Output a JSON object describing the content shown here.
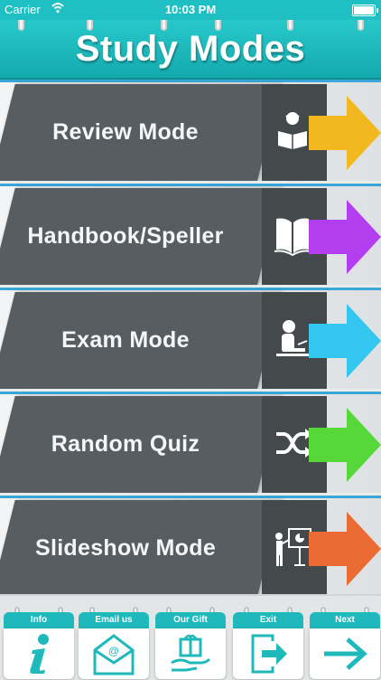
{
  "status_bar": {
    "carrier": "Carrier",
    "time": "10:03 PM"
  },
  "header": {
    "title": "Study Modes"
  },
  "modes": [
    {
      "label": "Review Mode",
      "icon": "reader-icon",
      "arrow_color": "#f2b81f"
    },
    {
      "label": "Handbook/Speller",
      "icon": "book-icon",
      "arrow_color": "#b23ef0"
    },
    {
      "label": "Exam Mode",
      "icon": "student-writing-icon",
      "arrow_color": "#33c6ee"
    },
    {
      "label": "Random Quiz",
      "icon": "shuffle-icon",
      "arrow_color": "#56d83b"
    },
    {
      "label": "Slideshow Mode",
      "icon": "presentation-icon",
      "arrow_color": "#ec6a33"
    }
  ],
  "bottom_bar": [
    {
      "label": "Info",
      "icon": "info-icon"
    },
    {
      "label": "Email us",
      "icon": "email-icon"
    },
    {
      "label": "Our Gift",
      "icon": "gift-icon"
    },
    {
      "label": "Exit",
      "icon": "exit-icon"
    },
    {
      "label": "Next",
      "icon": "next-arrow-icon"
    }
  ],
  "colors": {
    "accent": "#1fc0c3",
    "plate": "#585d61",
    "icon_box": "#44494c",
    "separator": "#3aa6d6"
  }
}
